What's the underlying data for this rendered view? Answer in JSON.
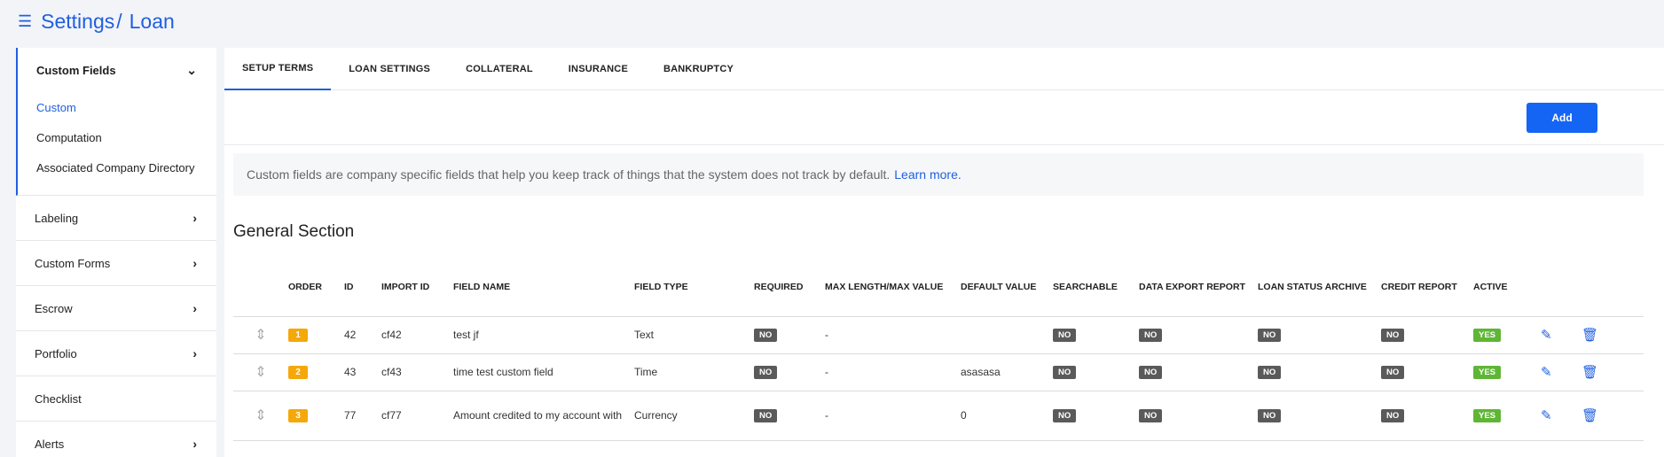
{
  "header": {
    "crumb_1": "Settings",
    "separator": "/",
    "crumb_2": "Loan",
    "menu_icon": "hamburger-icon"
  },
  "sidebar": {
    "custom_fields": {
      "label": "Custom Fields",
      "items": [
        "Custom",
        "Computation",
        "Associated Company Directory"
      ]
    },
    "items": [
      "Labeling",
      "Custom Forms",
      "Escrow",
      "Portfolio",
      "Checklist",
      "Alerts"
    ]
  },
  "tabs": [
    "SETUP TERMS",
    "LOAN SETTINGS",
    "COLLATERAL",
    "INSURANCE",
    "BANKRUPTCY"
  ],
  "toolbar": {
    "add_label": "Add"
  },
  "info": {
    "text": "Custom fields are company specific fields that help you keep track of things that the system does not track by default.",
    "link": "Learn more."
  },
  "section_title": "General Section",
  "table": {
    "headers": [
      "ORDER",
      "ID",
      "IMPORT ID",
      "FIELD NAME",
      "FIELD TYPE",
      "REQUIRED",
      "MAX LENGTH/MAX VALUE",
      "DEFAULT VALUE",
      "SEARCHABLE",
      "DATA EXPORT REPORT",
      "LOAN STATUS ARCHIVE",
      "CREDIT REPORT",
      "ACTIVE"
    ],
    "rows": [
      {
        "order": "1",
        "id": "42",
        "import_id": "cf42",
        "field_name": "test jf",
        "field_type": "Text",
        "required": "NO",
        "max": "-",
        "default": "",
        "searchable": "NO",
        "export": "NO",
        "archive": "NO",
        "credit": "NO",
        "active": "YES"
      },
      {
        "order": "2",
        "id": "43",
        "import_id": "cf43",
        "field_name": "time test custom field",
        "field_type": "Time",
        "required": "NO",
        "max": "-",
        "default": "asasasa",
        "searchable": "NO",
        "export": "NO",
        "archive": "NO",
        "credit": "NO",
        "active": "YES"
      },
      {
        "order": "3",
        "id": "77",
        "import_id": "cf77",
        "field_name": "Amount credited to my account with",
        "field_type": "Currency",
        "required": "NO",
        "max": "-",
        "default": "0",
        "searchable": "NO",
        "export": "NO",
        "archive": "NO",
        "credit": "NO",
        "active": "YES"
      }
    ]
  },
  "colors": {
    "accent": "#1f5fe0",
    "order_badge": "#f5a80a",
    "no_badge": "#5a5a5a",
    "yes_badge": "#5fb636"
  }
}
